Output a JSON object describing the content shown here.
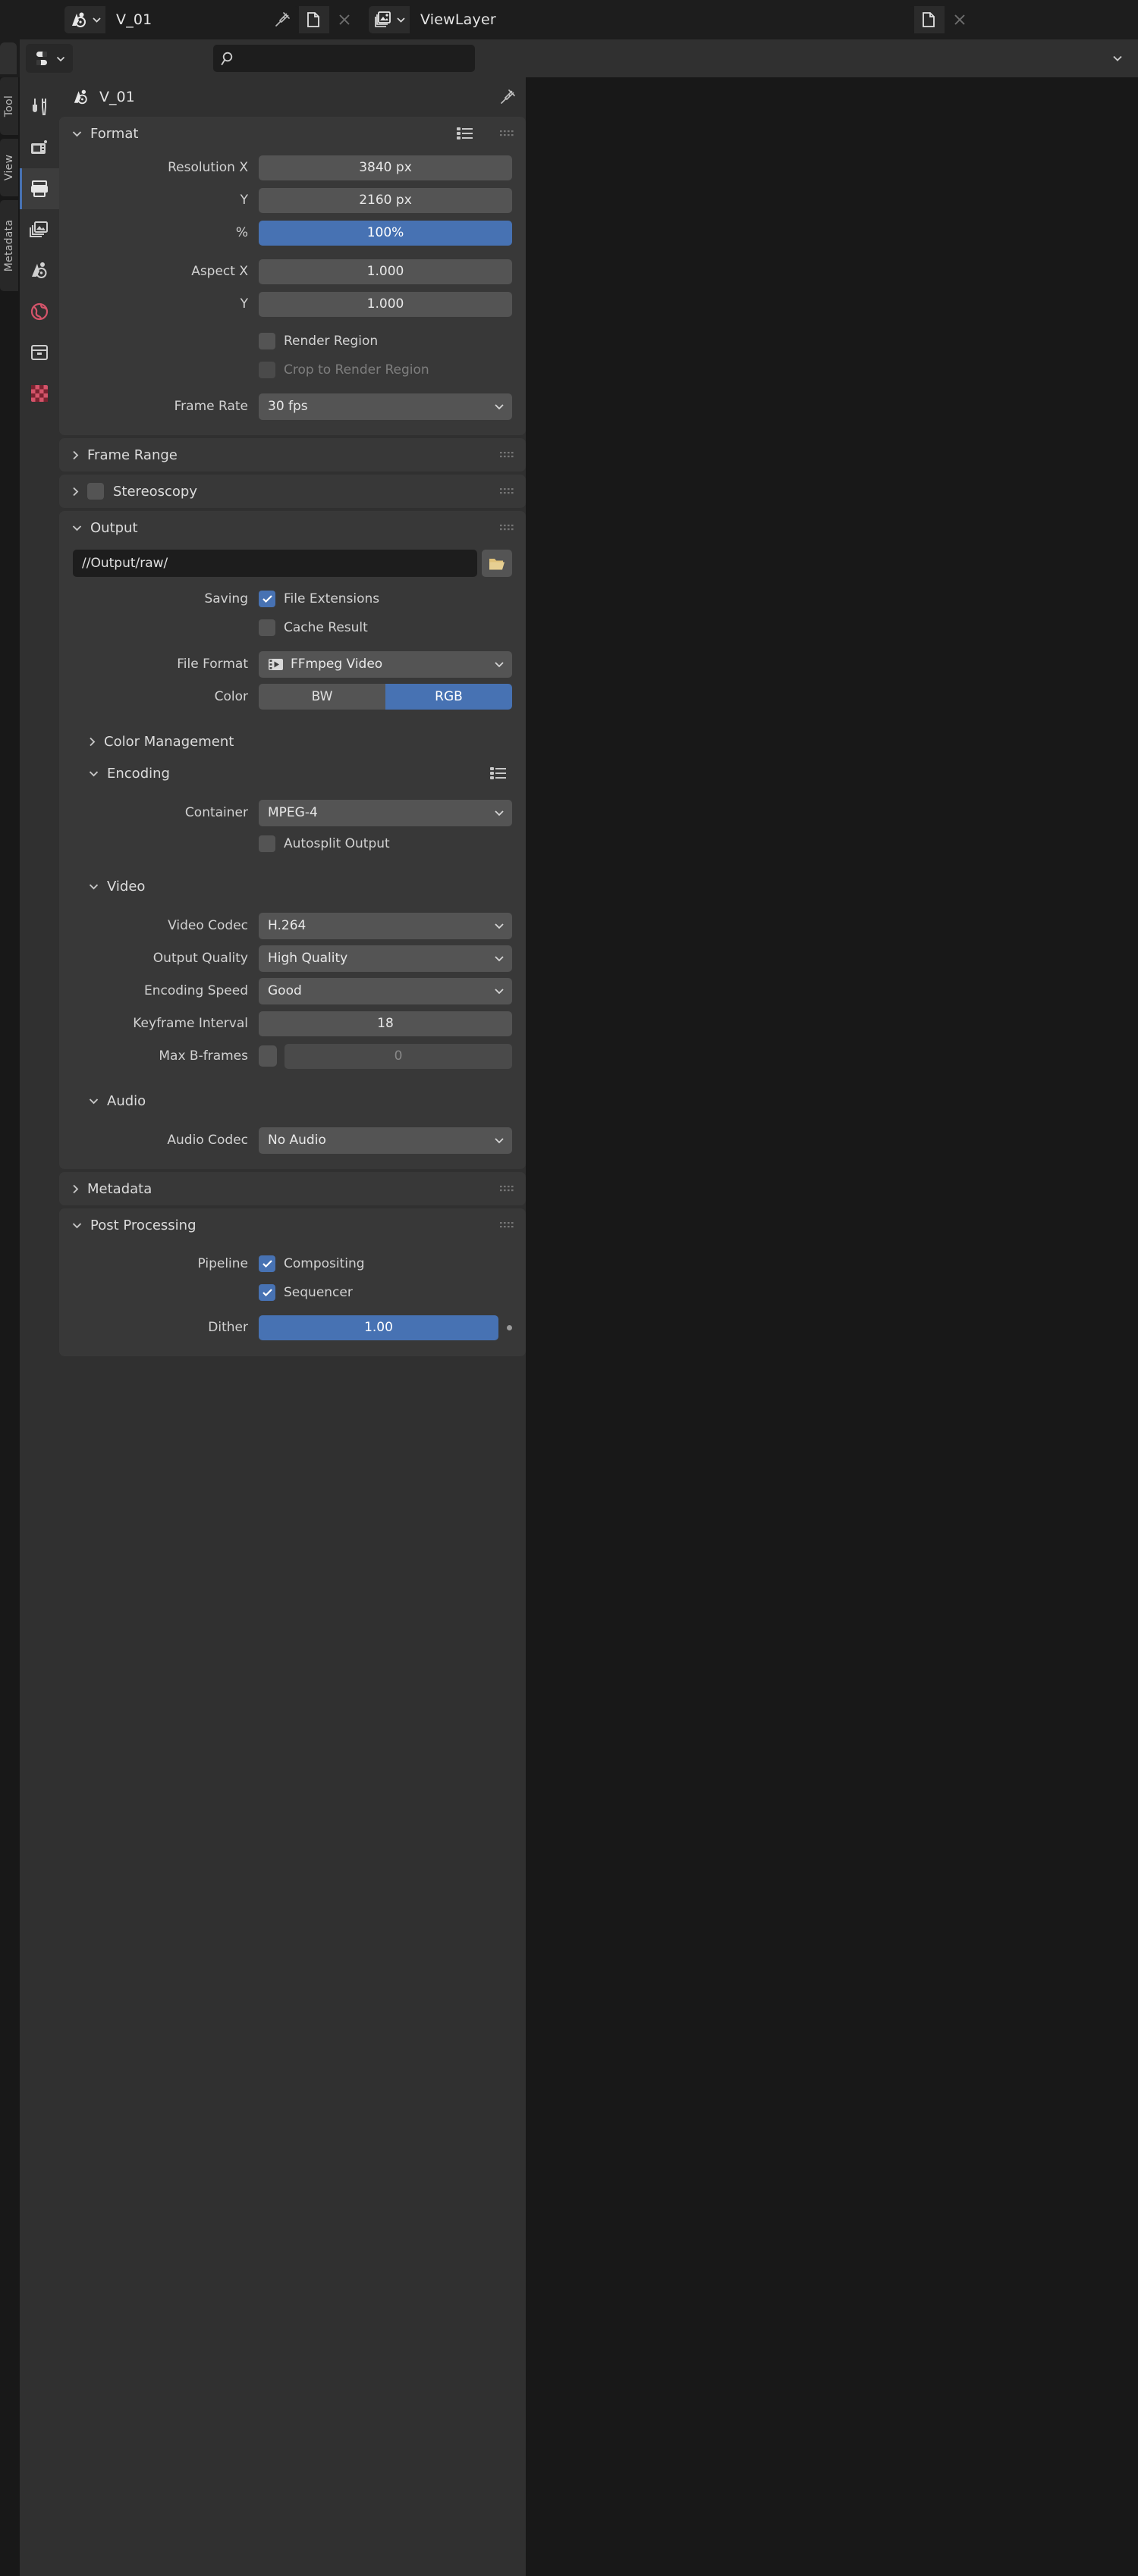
{
  "header": {
    "scene_name": "V_01",
    "view_layer_name": "ViewLayer",
    "icons": {
      "scene_icon": "scene-data-icon",
      "pin_icon": "pin-icon",
      "copy_icon": "new-copy-icon",
      "close_icon": "close-x-icon",
      "viewlayer_icon": "view-layer-icon",
      "dropdown_icon": "chevron-down-icon"
    }
  },
  "editor_header": {
    "editor_type": "properties-editor-icon",
    "search_placeholder": "",
    "search_value": "",
    "search_icon": "search-icon",
    "overflow_icon": "chevron-down-icon"
  },
  "vertical_tabs": [
    {
      "label": "Tool"
    },
    {
      "label": "View"
    },
    {
      "label": "Metadata"
    }
  ],
  "property_tabs": [
    {
      "name": "tool",
      "icon": "tool-wrench-icon",
      "active": false
    },
    {
      "name": "render",
      "icon": "camera-back-icon",
      "active": false
    },
    {
      "name": "output",
      "icon": "printer-icon",
      "active": true
    },
    {
      "name": "view-layer",
      "icon": "images-stack-icon",
      "active": false
    },
    {
      "name": "scene",
      "icon": "scene-cone-icon",
      "active": false
    },
    {
      "name": "world",
      "icon": "world-globe-icon",
      "active": false
    },
    {
      "name": "collection",
      "icon": "collection-box-icon",
      "active": false
    },
    {
      "name": "texture",
      "icon": "checker-texture-icon",
      "active": false
    }
  ],
  "panel": {
    "breadcrumb_title": "V_01",
    "breadcrumb_icon": "scene-data-icon",
    "pin_icon": "pin-icon"
  },
  "sections": {
    "format": {
      "title": "Format",
      "expanded": true,
      "rows": [
        {
          "label": "Resolution X",
          "value": "3840 px",
          "type": "number"
        },
        {
          "label": "Y",
          "value": "2160 px",
          "type": "number"
        },
        {
          "label": "%",
          "value": "100%",
          "type": "slider",
          "fill_pct": 100
        },
        {
          "label": "Aspect X",
          "value": "1.000",
          "type": "number"
        },
        {
          "label": "Y",
          "value": "1.000",
          "type": "number"
        }
      ],
      "checks": [
        {
          "label": "Render Region",
          "checked": false,
          "disabled": false
        },
        {
          "label": "Crop to Render Region",
          "checked": false,
          "disabled": true
        }
      ],
      "frame_rate": {
        "label": "Frame Rate",
        "value": "30 fps"
      }
    },
    "frame_range": {
      "title": "Frame Range",
      "expanded": false
    },
    "stereoscopy": {
      "title": "Stereoscopy",
      "expanded": false,
      "checked": false
    },
    "output": {
      "title": "Output",
      "expanded": true,
      "path": "//Output/raw/",
      "folder_icon": "folder-open-icon",
      "saving": {
        "label": "Saving",
        "items": [
          {
            "label": "File Extensions",
            "checked": true
          },
          {
            "label": "Cache Result",
            "checked": false
          }
        ]
      },
      "file_format": {
        "label": "File Format",
        "value": "FFmpeg Video",
        "icon": "movie-file-icon"
      },
      "color": {
        "label": "Color",
        "options": [
          "BW",
          "RGB"
        ],
        "selected": "RGB"
      },
      "color_management": {
        "title": "Color Management",
        "expanded": false
      },
      "encoding": {
        "title": "Encoding",
        "expanded": true,
        "container": {
          "label": "Container",
          "value": "MPEG-4"
        },
        "autosplit": {
          "label": "Autosplit Output",
          "checked": false
        },
        "video": {
          "title": "Video",
          "expanded": true,
          "rows": [
            {
              "label": "Video Codec",
              "value": "H.264",
              "type": "dropdown"
            },
            {
              "label": "Output Quality",
              "value": "High Quality",
              "type": "dropdown"
            },
            {
              "label": "Encoding Speed",
              "value": "Good",
              "type": "dropdown"
            },
            {
              "label": "Keyframe Interval",
              "value": "18",
              "type": "number"
            }
          ],
          "max_bframes": {
            "label": "Max B-frames",
            "checked": false,
            "value": "0"
          }
        },
        "audio": {
          "title": "Audio",
          "expanded": true,
          "audio_codec": {
            "label": "Audio Codec",
            "value": "No Audio"
          }
        }
      }
    },
    "metadata": {
      "title": "Metadata",
      "expanded": false
    },
    "post_processing": {
      "title": "Post Processing",
      "expanded": true,
      "pipeline": {
        "label": "Pipeline",
        "items": [
          {
            "label": "Compositing",
            "checked": true
          },
          {
            "label": "Sequencer",
            "checked": true
          }
        ]
      },
      "dither": {
        "label": "Dither",
        "value": "1.00",
        "fill_pct": 100
      }
    }
  },
  "colors": {
    "accent": "#4772b3",
    "panel_bg": "#303030",
    "block_bg": "#383838",
    "field_bg": "#545454",
    "text": "#dcdcdc",
    "world_icon": "#d4546a"
  }
}
